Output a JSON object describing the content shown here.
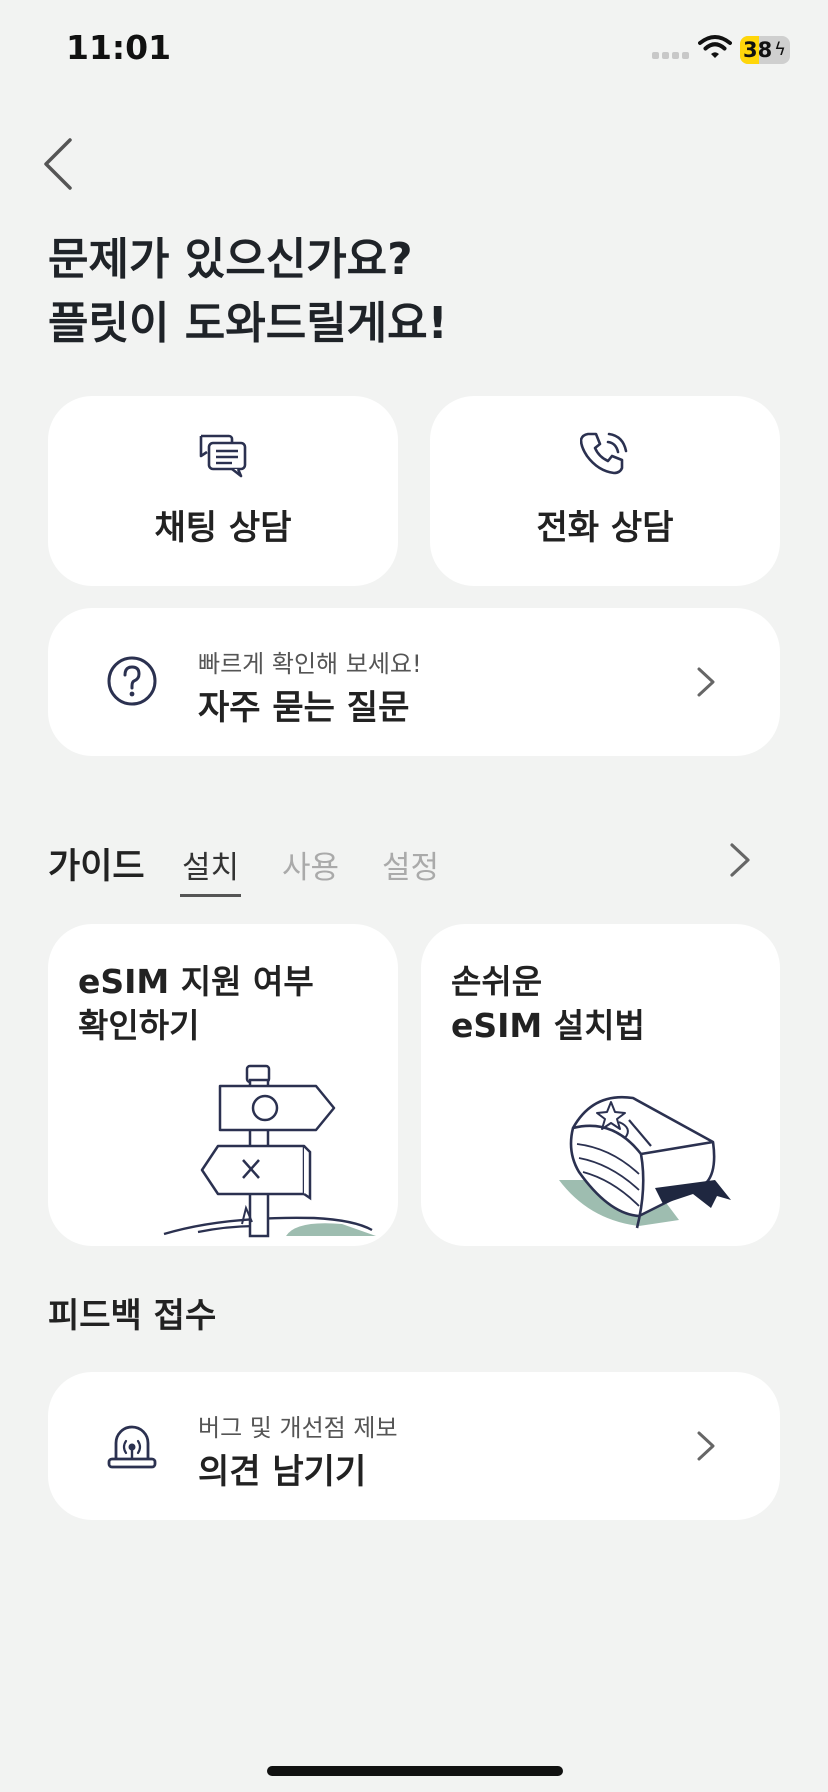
{
  "status_bar": {
    "time": "11:01",
    "battery": "38"
  },
  "header": {
    "title_line1": "문제가 있으신가요?",
    "title_line2": "플릿이 도와드릴게요!"
  },
  "support": {
    "chat_label": "채팅 상담",
    "call_label": "전화 상담"
  },
  "faq": {
    "subtitle": "빠르게 확인해 보세요!",
    "title": "자주 묻는 질문"
  },
  "guide": {
    "title": "가이드",
    "tabs": [
      "설치",
      "사용",
      "설정"
    ],
    "active_tab": "설치",
    "cards": [
      {
        "line1": "eSIM 지원 여부",
        "line2": "확인하기"
      },
      {
        "line1": "손쉬운",
        "line2": "eSIM 설치법"
      }
    ]
  },
  "feedback": {
    "section_title": "피드백 접수",
    "subtitle": "버그 및 개선점 제보",
    "title": "의견 남기기"
  },
  "colors": {
    "icon": "#2b3150",
    "accent_green": "#9ebdb0",
    "background": "#f2f3f2"
  }
}
